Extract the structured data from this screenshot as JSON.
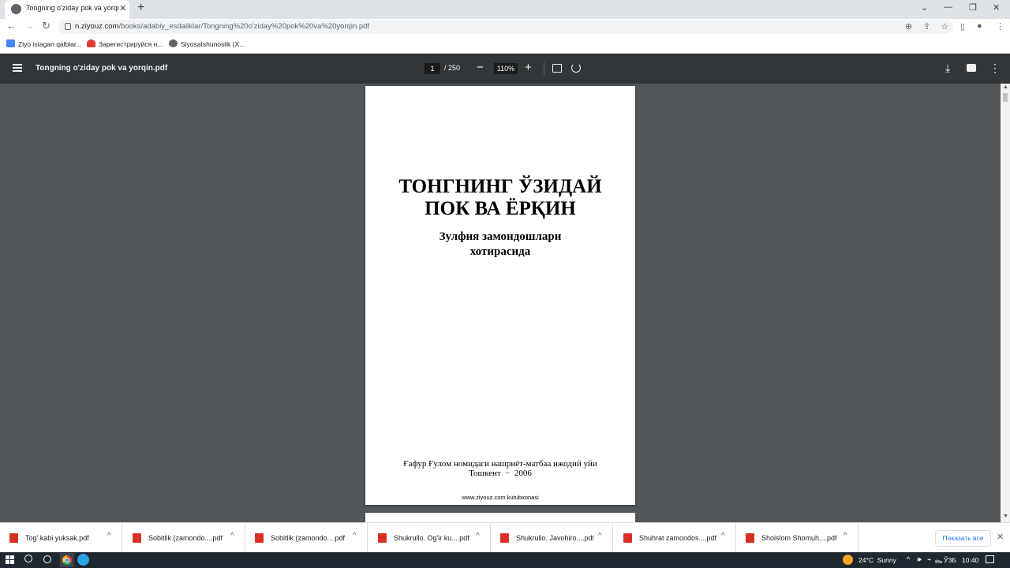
{
  "browser": {
    "tab_title": "Tongning o'ziday pok va yorqin.pdf",
    "new_tab": "+",
    "tab_close": "✕",
    "window_controls": [
      "⌄",
      "—",
      "❐",
      "✕"
    ],
    "url_host": "n.ziyouz.com",
    "url_path": "/books/adabiy_esdaliklar/Tongning%20o'ziday%20pok%20va%20yorqin.pdf",
    "nav": {
      "back": "←",
      "forward": "→",
      "reload": "↻"
    },
    "omnibox_icons": [
      "zoom-icon",
      "share-icon",
      "star-icon"
    ],
    "bookmarks": [
      {
        "label": "Ziyo istagan qalblar...",
        "icon_color": "#4285f4"
      },
      {
        "label": "Зарегистрируйся н...",
        "icon_color": "#e53935"
      },
      {
        "label": "Siyosatshunoslik (X...",
        "icon_color": "#5f6368"
      }
    ]
  },
  "pdf_toolbar": {
    "title": "Tongning o'ziday pok va yorqin.pdf",
    "page_current": "1",
    "page_total": "/ 250",
    "zoom_out": "−",
    "zoom": "110%",
    "zoom_in": "+",
    "download": "⤓",
    "more": "⋮"
  },
  "document": {
    "title_lines": [
      "ТОНГНИНГ ЎЗИДАЙ",
      "ПОК ВА ЁРҚИН"
    ],
    "subtitle_lines": [
      "Зулфия замондошлари",
      "хотирасида"
    ],
    "publisher_line": "Ғафур Ғулом номидаги нашриёт-матбаа ижодий уйи",
    "city_year": "Тошкент  −  2006",
    "footer": "www.ziyouz.com kutubxonasi"
  },
  "downloads": {
    "items": [
      "Tog' kabi yuksak.pdf",
      "Sobitlik (zamondo....pdf",
      "Sobitlik (zamondo....pdf",
      "Shukrullo. Og'ir ku....pdf",
      "Shukrullo. Javohiro....pdf",
      "Shuhrat zamondos....pdf",
      "Shoislom Shomuh....pdf"
    ],
    "chevron": "^",
    "show_all": "Показать все",
    "close": "✕"
  },
  "taskbar": {
    "weather": "24°C  Sunny",
    "tray_icons": [
      "^",
      "🕪",
      "⌁",
      "🖦"
    ],
    "language": "ЎЗБ",
    "time": "10:40"
  }
}
